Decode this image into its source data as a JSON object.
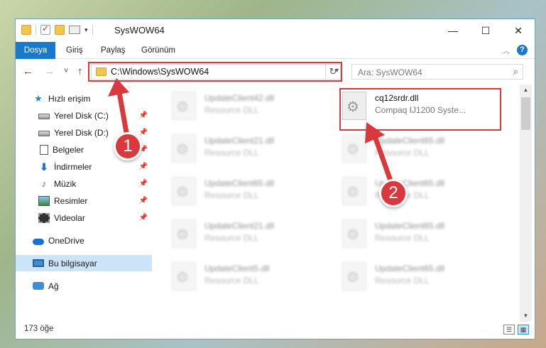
{
  "window": {
    "title": "SysWOW64",
    "minimize": "—",
    "maximize": "☐",
    "close": "✕"
  },
  "ribbon": {
    "tabs": [
      "Dosya",
      "Giriş",
      "Paylaş",
      "Görünüm"
    ],
    "active_tab": "Dosya",
    "help": "?"
  },
  "nav": {
    "back": "←",
    "forward": "→",
    "recent": "˅",
    "up": "↑",
    "address": "C:\\Windows\\SysWOW64",
    "refresh": "↻",
    "search_placeholder": "Ara: SysWOW64",
    "search_icon": "⌕"
  },
  "sidebar": {
    "items": [
      {
        "label": "Hızlı erişim",
        "icon": "star-icon"
      },
      {
        "label": "Yerel Disk (C:)",
        "icon": "disk-icon",
        "pinned": true
      },
      {
        "label": "Yerel Disk (D:)",
        "icon": "disk-icon",
        "pinned": true
      },
      {
        "label": "Belgeler",
        "icon": "document-icon",
        "pinned": true
      },
      {
        "label": "İndirmeler",
        "icon": "download-icon",
        "pinned": true
      },
      {
        "label": "Müzik",
        "icon": "music-icon",
        "pinned": true
      },
      {
        "label": "Resimler",
        "icon": "pictures-icon",
        "pinned": true
      },
      {
        "label": "Videolar",
        "icon": "video-icon",
        "pinned": true
      },
      {
        "label": "OneDrive",
        "icon": "cloud-icon"
      },
      {
        "label": "Bu bilgisayar",
        "icon": "computer-icon",
        "selected": true
      },
      {
        "label": "Ağ",
        "icon": "network-icon"
      }
    ]
  },
  "files": {
    "highlighted": {
      "name": "cq12srdr.dll",
      "type": "Compaq IJ1200 Syste..."
    },
    "left_column": [
      {
        "name": "UpdateClient42.dll",
        "type": "Resource DLL"
      },
      {
        "name": "UpdateClient21.dll",
        "type": "Resource DLL"
      },
      {
        "name": "UpdateClient65.dll",
        "type": "Resource DLL"
      },
      {
        "name": "UpdateClient21.dll",
        "type": "Resource DLL"
      },
      {
        "name": "UpdateClient5.dll",
        "type": "Resource DLL"
      }
    ],
    "right_column": [
      {
        "name": "UpdateClient65.dll",
        "type": "Resource DLL"
      },
      {
        "name": "UpdateClient65.dll",
        "type": "Resource DLL"
      },
      {
        "name": "UpdateClient65.dll",
        "type": "Resource DLL"
      },
      {
        "name": "UpdateClient65.dll",
        "type": "Resource DLL"
      }
    ]
  },
  "status": {
    "item_count": "173 öğe"
  },
  "annotations": {
    "step1": "1",
    "step2": "2",
    "color": "#d9383c"
  },
  "colors": {
    "accent": "#1979ca",
    "selection": "#cce4f7"
  }
}
